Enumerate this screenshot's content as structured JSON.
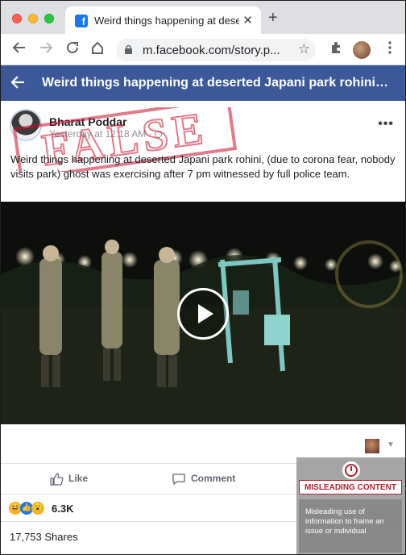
{
  "browser": {
    "tab_title": "Weird things happening at dese",
    "tab_close": "✕",
    "new_tab": "+",
    "url": "m.facebook.com/story.p...",
    "star": "☆"
  },
  "facebook": {
    "header_title": "Weird things happening at deserted Japani park rohini…"
  },
  "post": {
    "author": "Bharat Poddar",
    "time": "Yesterday at 12:18 AM · ",
    "text": "Weird things happening at deserted Japani park rohini, (due to corona fear, nobody visits park) ghost was exercising after 7 pm witnessed by full police team.",
    "stamp": "FALSE",
    "more": "•••"
  },
  "actions": {
    "like": "Like",
    "comment": "Comment"
  },
  "stats": {
    "reactions_count": "6.3K",
    "shares": "17,753 Shares"
  },
  "overlay": {
    "badge": "MISLEADING CONTENT",
    "description": "Misleading use of information to frame an issue or individual"
  },
  "colors": {
    "facebook_blue": "#3b5998",
    "stamp_red": "#c8102e"
  }
}
